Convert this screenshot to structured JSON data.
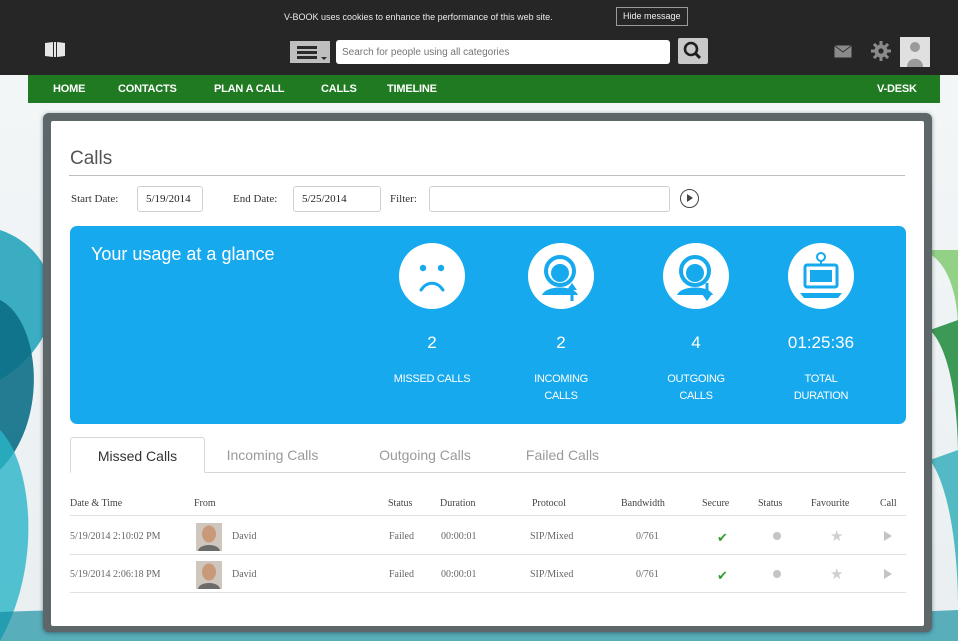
{
  "cookie_bar": {
    "message": "V-BOOK uses cookies to enhance the performance of this web site.",
    "hide_label": "Hide message"
  },
  "header": {
    "search_placeholder": "Search for people using all categories"
  },
  "nav": {
    "items": [
      "HOME",
      "CONTACTS",
      "PLAN A CALL",
      "CALLS",
      "TIMELINE"
    ],
    "right": "V-DESK"
  },
  "page": {
    "title": "Calls",
    "start_label": "Start Date:",
    "start_value": "5/19/2014",
    "end_label": "End Date:",
    "end_value": "5/25/2014",
    "filter_label": "Filter:",
    "filter_value": ""
  },
  "usage": {
    "title": "Your usage at a glance",
    "stats": [
      {
        "value": "2",
        "caption_1": "MISSED CALLS",
        "caption_2": "",
        "icon": "sad-face-icon"
      },
      {
        "value": "2",
        "caption_1": "INCOMING",
        "caption_2": "CALLS",
        "icon": "incoming-call-icon"
      },
      {
        "value": "4",
        "caption_1": "OUTGOING",
        "caption_2": "CALLS",
        "icon": "outgoing-call-icon"
      },
      {
        "value": "01:25:36",
        "caption_1": "TOTAL",
        "caption_2": "DURATION",
        "icon": "workstation-icon"
      }
    ]
  },
  "tabs": [
    "Missed Calls",
    "Incoming Calls",
    "Outgoing Calls",
    "Failed Calls"
  ],
  "table": {
    "headers": [
      "Date & Time",
      "From",
      "Status",
      "Duration",
      "Protocol",
      "Bandwidth",
      "Secure",
      "Status",
      "Favourite",
      "Call"
    ],
    "rows": [
      {
        "datetime": "5/19/2014 2:10:02 PM",
        "from": "David",
        "status": "Failed",
        "duration": "00:00:01",
        "protocol": "SIP/Mixed",
        "bandwidth": "0/761"
      },
      {
        "datetime": "5/19/2014 2:06:18 PM",
        "from": "David",
        "status": "Failed",
        "duration": "00:00:01",
        "protocol": "SIP/Mixed",
        "bandwidth": "0/761"
      }
    ]
  },
  "colors": {
    "nav_green": "#1f7a21",
    "usage_blue": "#17a9ee",
    "topbar": "#262626",
    "secure_check": "#2e9e2e"
  }
}
